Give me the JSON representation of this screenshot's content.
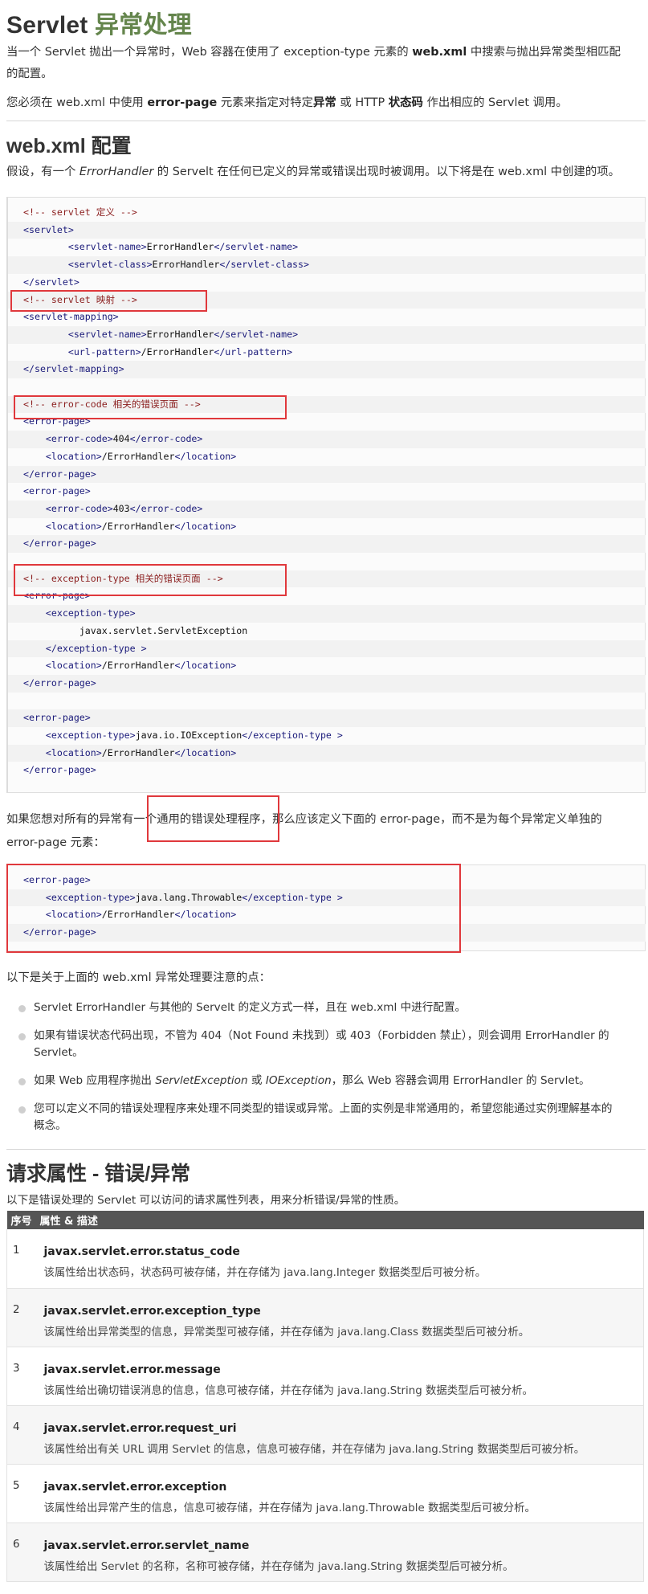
{
  "title": {
    "prefix": "Servlet",
    "highlight": "异常处理"
  },
  "intro": {
    "p1_a": "当一个 Servlet 抛出一个异常时，Web 容器在使用了 exception-type 元素的 ",
    "p1_b": "web.xml",
    "p1_c": " 中搜索与抛出异常类型相匹配",
    "p1_d": "的配置。",
    "p2_a": "您必须在 web.xml 中使用 ",
    "p2_b": "error-page",
    "p2_c": " 元素来指定对特定",
    "p2_d": "异常",
    "p2_e": " 或 HTTP ",
    "p2_f": "状态码",
    "p2_g": " 作出相应的 Servlet 调用。"
  },
  "webxml": {
    "heading": "web.xml 配置",
    "desc_a": "假设，有一个 ",
    "desc_b": "ErrorHandler",
    "desc_c": " 的 Servelt 在任何已定义的异常或错误出现时被调用。以下将是在 web.xml 中创建的项。",
    "code_lines": [
      {
        "indent": "",
        "parts": [
          {
            "c": "cm",
            "t": "<!-- servlet 定义 -->"
          }
        ]
      },
      {
        "indent": "",
        "parts": [
          {
            "c": "tg",
            "t": "<servlet>"
          }
        ]
      },
      {
        "indent": "        ",
        "parts": [
          {
            "c": "tg",
            "t": "<servlet-name>"
          },
          {
            "c": "tx",
            "t": "ErrorHandler"
          },
          {
            "c": "tg",
            "t": "</servlet-name>"
          }
        ]
      },
      {
        "indent": "        ",
        "parts": [
          {
            "c": "tg",
            "t": "<servlet-class>"
          },
          {
            "c": "tx",
            "t": "ErrorHandler"
          },
          {
            "c": "tg",
            "t": "</servlet-class>"
          }
        ]
      },
      {
        "indent": "",
        "parts": [
          {
            "c": "tg",
            "t": "</servlet>"
          }
        ]
      },
      {
        "indent": "",
        "parts": [
          {
            "c": "cm",
            "t": "<!-- servlet 映射 -->"
          }
        ]
      },
      {
        "indent": "",
        "parts": [
          {
            "c": "tg",
            "t": "<servlet-mapping>"
          }
        ]
      },
      {
        "indent": "        ",
        "parts": [
          {
            "c": "tg",
            "t": "<servlet-name>"
          },
          {
            "c": "tx",
            "t": "ErrorHandler"
          },
          {
            "c": "tg",
            "t": "</servlet-name>"
          }
        ]
      },
      {
        "indent": "        ",
        "parts": [
          {
            "c": "tg",
            "t": "<url-pattern>"
          },
          {
            "c": "tx",
            "t": "/ErrorHandler"
          },
          {
            "c": "tg",
            "t": "</url-pattern>"
          }
        ]
      },
      {
        "indent": "",
        "parts": [
          {
            "c": "tg",
            "t": "</servlet-mapping>"
          }
        ]
      },
      {
        "indent": "",
        "parts": []
      },
      {
        "indent": "",
        "parts": [
          {
            "c": "cm",
            "t": "<!-- error-code 相关的错误页面 -->"
          }
        ]
      },
      {
        "indent": "",
        "parts": [
          {
            "c": "tg",
            "t": "<error-page>"
          }
        ]
      },
      {
        "indent": "    ",
        "parts": [
          {
            "c": "tg",
            "t": "<error-code>"
          },
          {
            "c": "tx",
            "t": "404"
          },
          {
            "c": "tg",
            "t": "</error-code>"
          }
        ]
      },
      {
        "indent": "    ",
        "parts": [
          {
            "c": "tg",
            "t": "<location>"
          },
          {
            "c": "tx",
            "t": "/ErrorHandler"
          },
          {
            "c": "tg",
            "t": "</location>"
          }
        ]
      },
      {
        "indent": "",
        "parts": [
          {
            "c": "tg",
            "t": "</error-page>"
          }
        ]
      },
      {
        "indent": "",
        "parts": [
          {
            "c": "tg",
            "t": "<error-page>"
          }
        ]
      },
      {
        "indent": "    ",
        "parts": [
          {
            "c": "tg",
            "t": "<error-code>"
          },
          {
            "c": "tx",
            "t": "403"
          },
          {
            "c": "tg",
            "t": "</error-code>"
          }
        ]
      },
      {
        "indent": "    ",
        "parts": [
          {
            "c": "tg",
            "t": "<location>"
          },
          {
            "c": "tx",
            "t": "/ErrorHandler"
          },
          {
            "c": "tg",
            "t": "</location>"
          }
        ]
      },
      {
        "indent": "",
        "parts": [
          {
            "c": "tg",
            "t": "</error-page>"
          }
        ]
      },
      {
        "indent": "",
        "parts": []
      },
      {
        "indent": "",
        "parts": [
          {
            "c": "cm",
            "t": "<!-- exception-type 相关的错误页面 -->"
          }
        ]
      },
      {
        "indent": "",
        "parts": [
          {
            "c": "tg",
            "t": "<error-page>"
          }
        ]
      },
      {
        "indent": "    ",
        "parts": [
          {
            "c": "tg",
            "t": "<exception-type>"
          }
        ]
      },
      {
        "indent": "          ",
        "parts": [
          {
            "c": "tx",
            "t": "javax.servlet.ServletException"
          }
        ]
      },
      {
        "indent": "    ",
        "parts": [
          {
            "c": "tg",
            "t": "</exception-type >"
          }
        ]
      },
      {
        "indent": "    ",
        "parts": [
          {
            "c": "tg",
            "t": "<location>"
          },
          {
            "c": "tx",
            "t": "/ErrorHandler"
          },
          {
            "c": "tg",
            "t": "</location>"
          }
        ]
      },
      {
        "indent": "",
        "parts": [
          {
            "c": "tg",
            "t": "</error-page>"
          }
        ]
      },
      {
        "indent": "",
        "parts": []
      },
      {
        "indent": "",
        "parts": [
          {
            "c": "tg",
            "t": "<error-page>"
          }
        ]
      },
      {
        "indent": "    ",
        "parts": [
          {
            "c": "tg",
            "t": "<exception-type>"
          },
          {
            "c": "tx",
            "t": "java.io.IOException"
          },
          {
            "c": "tg",
            "t": "</exception-type >"
          }
        ]
      },
      {
        "indent": "    ",
        "parts": [
          {
            "c": "tg",
            "t": "<location>"
          },
          {
            "c": "tx",
            "t": "/ErrorHandler"
          },
          {
            "c": "tg",
            "t": "</location>"
          }
        ]
      },
      {
        "indent": "",
        "parts": [
          {
            "c": "tg",
            "t": "</error-page>"
          }
        ]
      }
    ]
  },
  "generic": {
    "text_a": "如果您想对所有的异常有一个",
    "text_b": "通用的错误处理程序",
    "text_c": "，那么应该定义下面的 error-page，而不是为每个异常定义单独的",
    "text_d": "error-page 元素：",
    "code_lines": [
      {
        "indent": "",
        "parts": [
          {
            "c": "tg",
            "t": "<error-page>"
          }
        ]
      },
      {
        "indent": "    ",
        "parts": [
          {
            "c": "tg",
            "t": "<exception-type>"
          },
          {
            "c": "tx",
            "t": "java.lang.Throwable"
          },
          {
            "c": "tg",
            "t": "</exception-type >"
          }
        ]
      },
      {
        "indent": "    ",
        "parts": [
          {
            "c": "tg",
            "t": "<location>"
          },
          {
            "c": "tx",
            "t": "/ErrorHandler"
          },
          {
            "c": "tg",
            "t": "</location>"
          }
        ]
      },
      {
        "indent": "",
        "parts": [
          {
            "c": "tg",
            "t": "</error-page>"
          }
        ]
      }
    ]
  },
  "notes": {
    "intro": "以下是关于上面的 web.xml 异常处理要注意的点：",
    "items": [
      {
        "l1": "Servlet ErrorHandler 与其他的 Servelt 的定义方式一样，且在 web.xml 中进行配置。",
        "l2": ""
      },
      {
        "l1": "如果有错误状态代码出现，不管为 404（Not Found 未找到）或 403（Forbidden 禁止），则会调用 ErrorHandler 的",
        "l2": "Servlet。"
      },
      {
        "l1_a": "如果 Web 应用程序抛出 ",
        "l1_b": "ServletException",
        "l1_c": " 或 ",
        "l1_d": "IOException",
        "l1_e": "，那么 Web 容器会调用 ErrorHandler 的 Servlet。"
      },
      {
        "l1": "您可以定义不同的错误处理程序来处理不同类型的错误或异常。上面的实例是非常通用的，希望您能通过实例理解基本的",
        "l2": "概念。"
      }
    ]
  },
  "request_attrs": {
    "heading": "请求属性 - 错误/异常",
    "desc": "以下是错误处理的 Servlet 可以访问的请求属性列表，用来分析错误/异常的性质。",
    "col_num": "序号",
    "col_desc": "属性 & 描述",
    "rows": [
      {
        "num": "1",
        "name": "javax.servlet.error.status_code",
        "desc": "该属性给出状态码，状态码可被存储，并在存储为 java.lang.Integer 数据类型后可被分析。"
      },
      {
        "num": "2",
        "name": "javax.servlet.error.exception_type",
        "desc": "该属性给出异常类型的信息，异常类型可被存储，并在存储为 java.lang.Class 数据类型后可被分析。"
      },
      {
        "num": "3",
        "name": "javax.servlet.error.message",
        "desc": "该属性给出确切错误消息的信息，信息可被存储，并在存储为 java.lang.String 数据类型后可被分析。"
      },
      {
        "num": "4",
        "name": "javax.servlet.error.request_uri",
        "desc": "该属性给出有关 URL 调用 Servlet 的信息，信息可被存储，并在存储为 java.lang.String 数据类型后可被分析。"
      },
      {
        "num": "5",
        "name": "javax.servlet.error.exception",
        "desc": "该属性给出异常产生的信息，信息可被存储，并在存储为 java.lang.Throwable 数据类型后可被分析。"
      },
      {
        "num": "6",
        "name": "javax.servlet.error.servlet_name",
        "desc": "该属性给出 Servlet 的名称，名称可被存储，并在存储为 java.lang.String 数据类型后可被分析。"
      }
    ]
  }
}
